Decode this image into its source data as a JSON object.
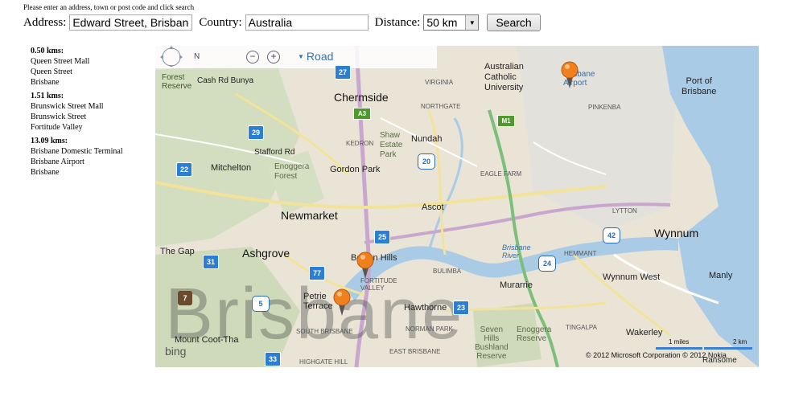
{
  "instructions": "Please enter an address, town or post code and click search",
  "form": {
    "address_label": "Address:",
    "address_value": "Edward Street, Brisbane",
    "country_label": "Country:",
    "country_value": "Australia",
    "distance_label": "Distance:",
    "distance_value": "50 km",
    "search_label": "Search"
  },
  "results": [
    {
      "distance": "0.50 kms:",
      "lines": [
        "Queen Street Mall",
        "Queen Street",
        "Brisbane"
      ]
    },
    {
      "distance": "1.51 kms:",
      "lines": [
        "Brunswick Street Mall",
        "Brunswick Street",
        "Fortitude Valley"
      ]
    },
    {
      "distance": "13.09 kms:",
      "lines": [
        "Brisbane Domestic Terminal",
        "Brisbane Airport",
        "Brisbane"
      ]
    }
  ],
  "map": {
    "compass": "N",
    "zoom_out": "⊖",
    "zoom_in": "⊕",
    "style": "Road",
    "watermark": "Brisbane",
    "bing": "bing",
    "copyright": "© 2012 Microsoft Corporation   © 2012 Nokia",
    "scale_miles": "1 miles",
    "scale_km": "2 km",
    "labels": {
      "forest_reserve": "Forest\nReserve",
      "bunya": "Cash Rd Bunya",
      "chermside": "Chermside",
      "acu": "Australian\nCatholic\nUniversity",
      "airport": "Brisbane\nAirport",
      "port": "Port of\nBrisbane",
      "pinkenba": "PINKENBA",
      "virginia": "VIRGINIA",
      "northgate": "NORTHGATE",
      "kedron": "KEDRON",
      "shaw": "Shaw\nEstate\nPark",
      "nundah": "Nundah",
      "stafford": "Stafford Rd",
      "mitchelton": "Mitchelton",
      "enoggera_forest": "Enoggera\nForest",
      "gordon_park": "Gordon Park",
      "eagle_farm": "EAGLE FARM",
      "newmarket": "Newmarket",
      "ascot": "Ascot",
      "lytton": "LYTTON",
      "wynnum": "Wynnum",
      "the_gap": "The Gap",
      "ashgrove": "Ashgrove",
      "bowen_hills": "Bowen Hills",
      "fortitude_valley": "FORTITUDE\nVALLEY",
      "bulimba": "BULIMBA",
      "hemmant": "HEMMANT",
      "murarrie": "Murarrie",
      "wynnum_west": "Wynnum West",
      "manly": "Manly",
      "petrie_terrace": "Petrie\nTerrace",
      "hawthorne": "Hawthorne",
      "mount_coot_tha": "Mount Coot-Tha",
      "south_brisbane": "SOUTH BRISBANE",
      "norman_park": "NORMAN PARK",
      "seven_hills": "Seven\nHills\nBushland\nReserve",
      "enoggera_reserve": "Enoggera\nReserve",
      "wakerley": "Wakerley",
      "highgate_hill": "HIGHGATE HILL",
      "east_brisbane": "EAST BRISBANE",
      "ransome": "Ransome",
      "brisbane_river": "Brisbane\nRiver",
      "tingalpa": "TINGALPA"
    },
    "shields": [
      "27",
      "29",
      "22",
      "31",
      "77",
      "25",
      "23",
      "33",
      "5"
    ],
    "hexes": [
      "20",
      "42",
      "24"
    ],
    "motorways": [
      "A3",
      "M1"
    ],
    "park_badge": "7"
  }
}
